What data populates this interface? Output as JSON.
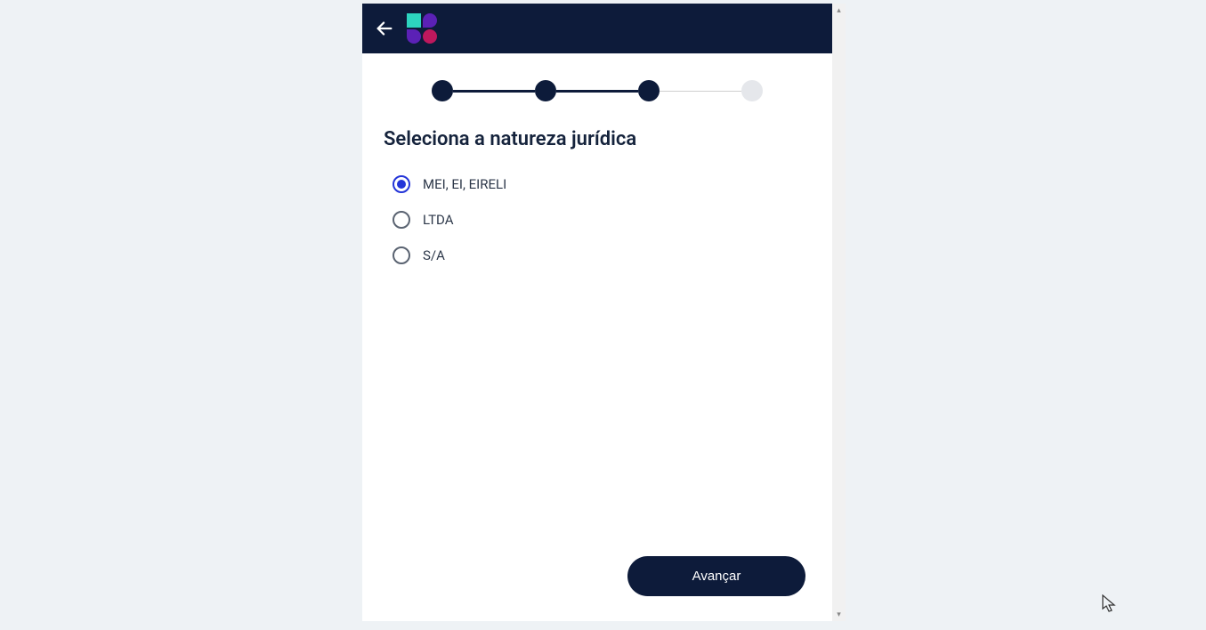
{
  "stepper": {
    "total": 4,
    "current": 3
  },
  "question": {
    "title": "Seleciona a natureza jurídica"
  },
  "options": [
    {
      "label": "MEI, EI, EIRELI",
      "selected": true
    },
    {
      "label": "LTDA",
      "selected": false
    },
    {
      "label": "S/A",
      "selected": false
    }
  ],
  "buttons": {
    "next": "Avançar"
  }
}
